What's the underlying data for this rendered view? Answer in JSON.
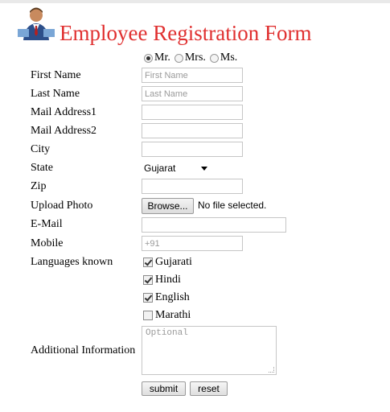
{
  "header": {
    "title": "Employee Registration Form"
  },
  "salutation": {
    "options": [
      "Mr.",
      "Mrs.",
      "Ms."
    ],
    "selected": "Mr."
  },
  "form": {
    "first_name": {
      "label": "First Name",
      "placeholder": "First Name",
      "value": ""
    },
    "last_name": {
      "label": "Last Name",
      "placeholder": "Last Name",
      "value": ""
    },
    "mail_address1": {
      "label": "Mail Address1",
      "value": ""
    },
    "mail_address2": {
      "label": "Mail Address2",
      "value": ""
    },
    "city": {
      "label": "City",
      "value": ""
    },
    "state": {
      "label": "State",
      "selected": "Gujarat"
    },
    "zip": {
      "label": "Zip",
      "value": ""
    },
    "upload_photo": {
      "label": "Upload Photo",
      "button": "Browse...",
      "status": "No file selected."
    },
    "email": {
      "label": "E-Mail",
      "value": ""
    },
    "mobile": {
      "label": "Mobile",
      "placeholder": "+91",
      "value": ""
    },
    "languages": {
      "label": "Languages known",
      "options": [
        {
          "name": "Gujarati",
          "checked": true
        },
        {
          "name": "Hindi",
          "checked": true
        },
        {
          "name": "English",
          "checked": true
        },
        {
          "name": "Marathi",
          "checked": false
        }
      ]
    },
    "additional_info": {
      "label": "Additional Information",
      "placeholder": "Optional"
    }
  },
  "buttons": {
    "submit": "submit",
    "reset": "reset"
  },
  "colors": {
    "title": "#e03030",
    "field_border": "#c6c6c6",
    "placeholder": "#9a9a9a"
  },
  "icons": {
    "logo": "employee-avatar-icon"
  }
}
